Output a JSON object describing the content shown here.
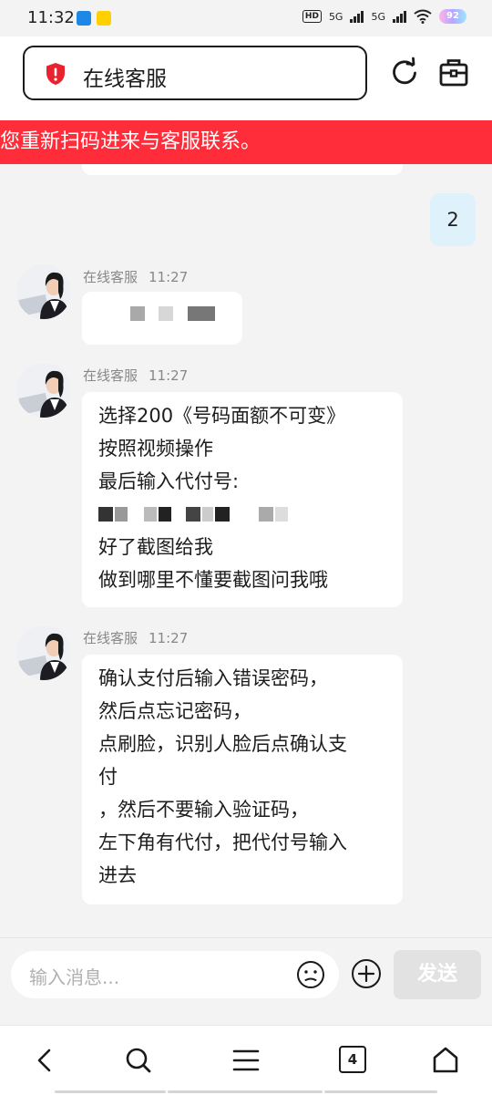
{
  "status_bar": {
    "time": "11:32",
    "hd_label": "HD",
    "net1": "5G",
    "net2": "5G",
    "battery": "92"
  },
  "header": {
    "title": "在线客服",
    "icons": [
      "shield-icon",
      "refresh-icon",
      "toolbox-icon"
    ]
  },
  "banner": {
    "text": "您重新扫码进来与客服联系。"
  },
  "messages": [
    {
      "sender": "me",
      "text": "2"
    },
    {
      "sender": "在线客服",
      "time": "11:27",
      "lines": []
    },
    {
      "sender": "在线客服",
      "time": "11:27",
      "lines": [
        "选择200《号码面额不可变》",
        "按照视频操作",
        "最后输入代付号:",
        "",
        "好了截图给我",
        "做到哪里不懂要截图问我哦"
      ]
    },
    {
      "sender": "在线客服",
      "time": "11:27",
      "lines": [
        "确认支付后输入错误密码，",
        "然后点忘记密码，",
        "点刷脸，识别人脸后点确认支",
        "付",
        "，然后不要输入验证码，",
        "左下角有代付，把代付号输入",
        "进去"
      ]
    }
  ],
  "input_bar": {
    "placeholder": "输入消息...",
    "send_label": "发送"
  },
  "nav_bar": {
    "tab_count": "4"
  },
  "colors": {
    "banner": "#ff2d3a",
    "my_bubble": "#dff1fb",
    "shield": "#e8232f"
  }
}
